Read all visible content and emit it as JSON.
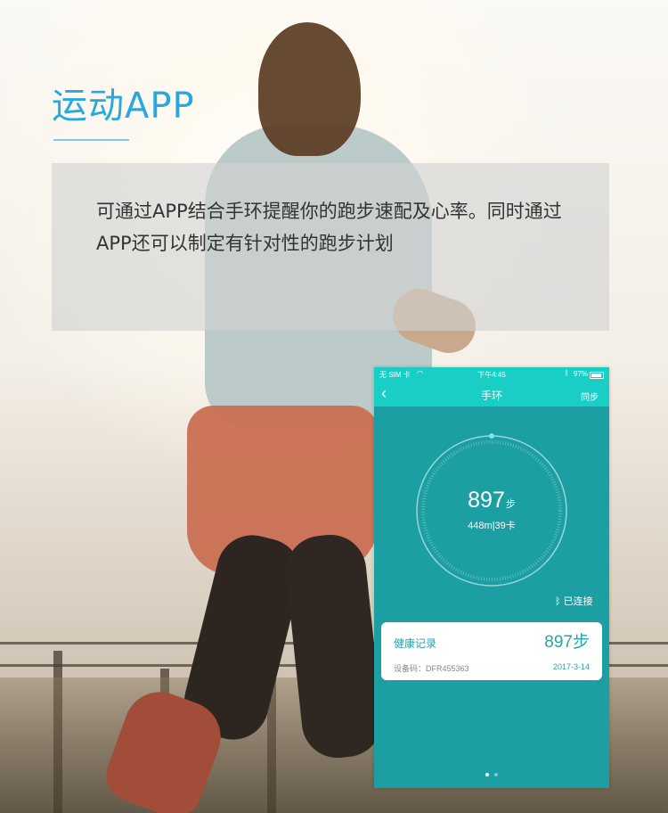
{
  "header": {
    "title": "运动APP"
  },
  "description": {
    "text": "可通过APP结合手环提醒你的跑步速配及心率。同时通过APP还可以制定有针对性的跑步计划"
  },
  "phone": {
    "status": {
      "carrier": "无 SIM 卡",
      "time": "下午4:45",
      "battery": "97%"
    },
    "nav": {
      "back": "‹",
      "title": "手环",
      "sync": "同步"
    },
    "progress": {
      "steps": "897",
      "steps_unit": "步",
      "sub": "448m|39卡"
    },
    "connection": "已连接",
    "record": {
      "label": "健康记录",
      "steps": "897步",
      "device": "设备码：DFR455363",
      "date": "2017-3-14"
    }
  },
  "colors": {
    "accent": "#29a8de",
    "phone_header": "#19cfc5",
    "phone_bg": "#1b9fa3",
    "record_text": "#2ba1ad"
  }
}
